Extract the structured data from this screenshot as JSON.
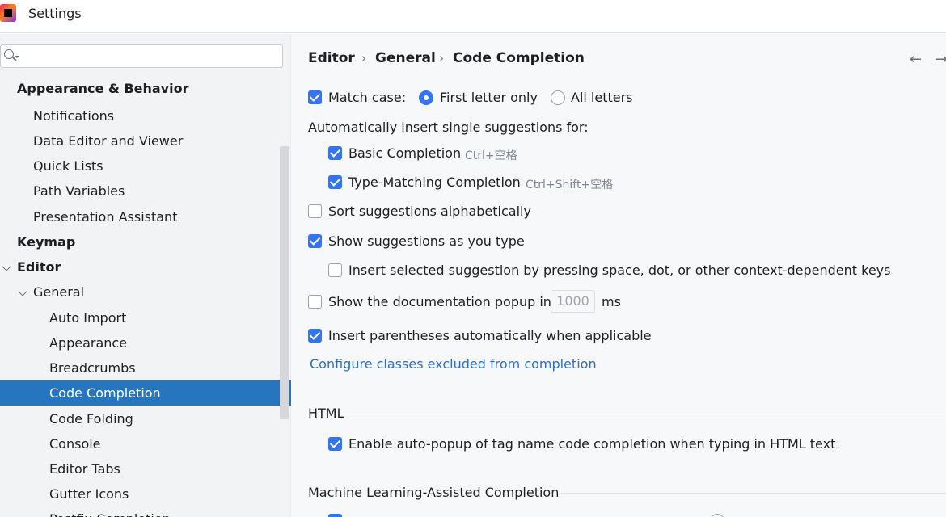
{
  "window": {
    "title": "Settings"
  },
  "search": {
    "placeholder": "",
    "value": ""
  },
  "sidebar": {
    "items": [
      {
        "label": "Appearance & Behavior",
        "level": 0,
        "bold": true
      },
      {
        "label": "Notifications",
        "level": 1
      },
      {
        "label": "Data Editor and Viewer",
        "level": 1
      },
      {
        "label": "Quick Lists",
        "level": 1
      },
      {
        "label": "Path Variables",
        "level": 1
      },
      {
        "label": "Presentation Assistant",
        "level": 1
      },
      {
        "label": "Keymap",
        "level": 0,
        "bold": true
      },
      {
        "label": "Editor",
        "level": 0,
        "bold": true,
        "expanded": true
      },
      {
        "label": "General",
        "level": 1,
        "expanded": true
      },
      {
        "label": "Auto Import",
        "level": 2
      },
      {
        "label": "Appearance",
        "level": 2
      },
      {
        "label": "Breadcrumbs",
        "level": 2
      },
      {
        "label": "Code Completion",
        "level": 2,
        "selected": true
      },
      {
        "label": "Code Folding",
        "level": 2
      },
      {
        "label": "Console",
        "level": 2
      },
      {
        "label": "Editor Tabs",
        "level": 2
      },
      {
        "label": "Gutter Icons",
        "level": 2
      },
      {
        "label": "Postfix Completion",
        "level": 2
      }
    ]
  },
  "breadcrumb": [
    "Editor",
    "General",
    "Code Completion"
  ],
  "nav": {
    "back_icon": "arrow-left-icon",
    "forward_icon": "arrow-right-icon"
  },
  "options": {
    "match_case": {
      "label": "Match case:",
      "checked": true
    },
    "match_first": {
      "label": "First letter only",
      "selected": true
    },
    "match_all": {
      "label": "All letters",
      "selected": false
    },
    "auto_insert_heading": "Automatically insert single suggestions for:",
    "basic_completion": {
      "label": "Basic Completion",
      "shortcut": "Ctrl+空格",
      "checked": true
    },
    "type_matching": {
      "label": "Type-Matching Completion",
      "shortcut": "Ctrl+Shift+空格",
      "checked": true
    },
    "sort_alpha": {
      "label": "Sort suggestions alphabetically",
      "checked": false
    },
    "show_as_type": {
      "label": "Show suggestions as you type",
      "checked": true
    },
    "insert_selected": {
      "label": "Insert selected suggestion by pressing space, dot, or other context-dependent keys",
      "checked": false
    },
    "doc_popup": {
      "label": "Show the documentation popup in",
      "value": "1000",
      "unit": "ms",
      "checked": false
    },
    "insert_parens": {
      "label": "Insert parentheses automatically when applicable",
      "checked": true
    },
    "configure_link": "Configure classes excluded from completion"
  },
  "html_section": {
    "title": "HTML",
    "auto_popup": {
      "label": "Enable auto-popup of tag name code completion when typing in HTML text",
      "checked": true
    }
  },
  "ml_section": {
    "title": "Machine Learning-Assisted Completion"
  },
  "colors": {
    "accent": "#3574f0",
    "selection": "#2675bf",
    "link": "#2e6ec2"
  }
}
